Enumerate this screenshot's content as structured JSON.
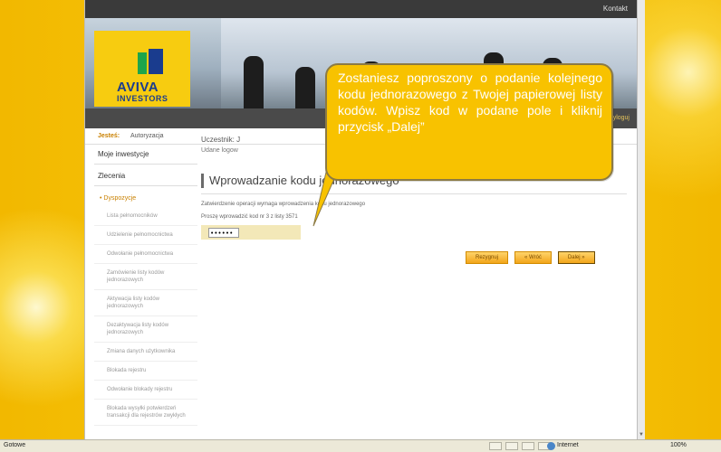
{
  "header": {
    "contact_link": "Kontakt",
    "logout_link": "Wyloguj"
  },
  "logo": {
    "line1": "AVIVA",
    "line2": "INVESTORS"
  },
  "breadcrumb": {
    "label": "Jesteś:",
    "value": "Autoryzacja"
  },
  "sidebar": {
    "heading1": "Moje inwestycje",
    "heading2": "Zlecenia",
    "subheading": "• Dyspozycje",
    "items": [
      "Lista pełnomocników",
      "Udzielenie pełnomocnictwa",
      "Odwołanie pełnomocnictwa",
      "Zamówienie listy kodów jednorazowych",
      "Aktywacja listy kodów jednorazowych",
      "Dezaktywacja listy kodów jednorazowych",
      "Zmiana danych użytkownika",
      "Blokada rejestru",
      "Odwołanie blokady rejestru",
      "Blokada wysyłki potwierdzeń transakcji dla rejestrów zwykłych"
    ]
  },
  "main": {
    "participant": "Uczestnik: J",
    "login_status": "Udane logow",
    "title": "Wprowadzanie kodu jednorazowego",
    "note": "Zatwierdzenie operacji wymaga wprowadzenia kodu jednorazowego",
    "prompt": "Proszę wprowadzić kod nr 3 z listy 3571",
    "code_value": "••••••",
    "buttons": {
      "cancel": "Rezygnuj",
      "back": "« Wróć",
      "next": "Dalej »"
    }
  },
  "callout": {
    "text": "Zostaniesz poproszony o podanie kolejnego kodu jednorazowego z Twojej papierowej listy kodów. Wpisz kod w podane pole i kliknij przycisk „Dalej”"
  },
  "statusbar": {
    "status": "Gotowe",
    "zone": "Internet",
    "zoom": "100%"
  },
  "colors": {
    "brand_yellow": "#f8c200",
    "brand_blue": "#1a3c8e",
    "brand_green": "#1ea54b"
  }
}
